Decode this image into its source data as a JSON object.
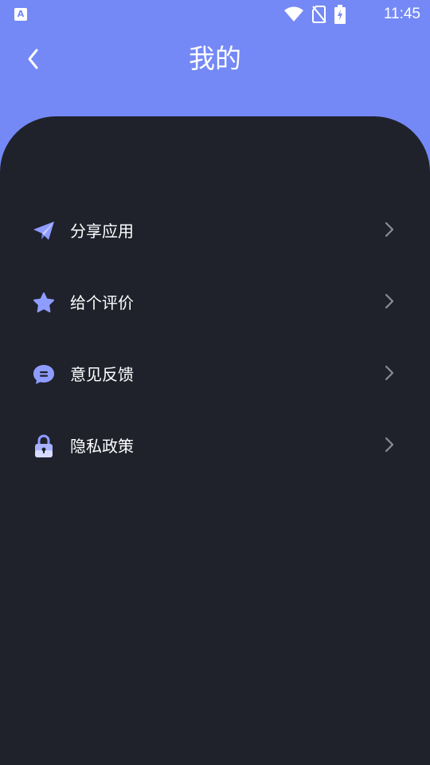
{
  "status_bar": {
    "time": "11:45",
    "left_icon_letter": "A",
    "icons": [
      "wifi-icon",
      "no-sim-icon",
      "battery-charging-icon"
    ]
  },
  "header": {
    "title": "我的",
    "back_icon": "chevron-left-icon"
  },
  "menu": {
    "items": [
      {
        "label": "分享应用",
        "icon": "paper-plane-icon"
      },
      {
        "label": "给个评价",
        "icon": "star-icon"
      },
      {
        "label": "意见反馈",
        "icon": "chat-bubble-icon"
      },
      {
        "label": "隐私政策",
        "icon": "lock-icon"
      }
    ]
  },
  "colors": {
    "header_bg": "#7489f6",
    "content_bg": "#1f222b",
    "icon_accent": "#8f9cff",
    "chevron": "#8a8d96"
  }
}
